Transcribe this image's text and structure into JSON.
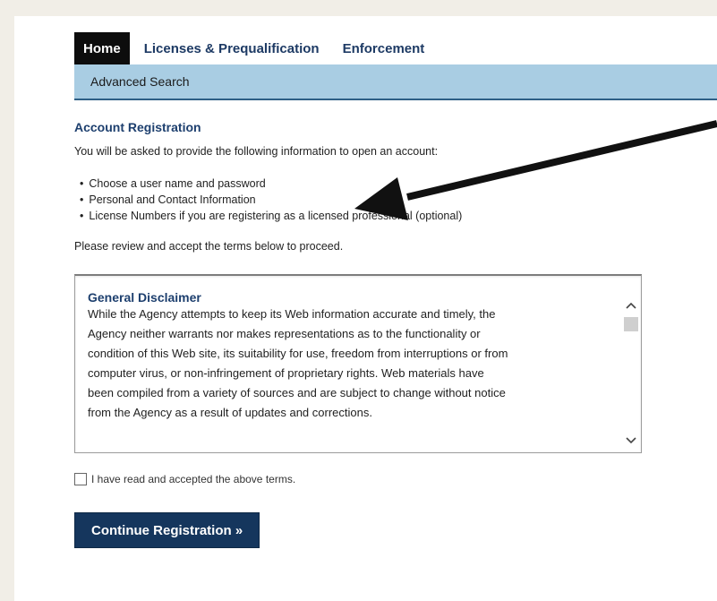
{
  "tabs": [
    {
      "label": "Home",
      "active": true
    },
    {
      "label": "Licenses & Prequalification",
      "active": false
    },
    {
      "label": "Enforcement",
      "active": false
    }
  ],
  "subnav": {
    "link": "Advanced Search"
  },
  "registration": {
    "title": "Account Registration",
    "intro": "You will be asked to provide the following information to open an account:",
    "bullets": [
      "Choose a user name and password",
      "Personal and Contact Information",
      "License Numbers if you are registering as a licensed professional (optional)"
    ],
    "review": "Please review and accept the terms below to proceed."
  },
  "terms": {
    "title": "General Disclaimer",
    "lines": [
      "While the Agency attempts to keep its Web information accurate and timely, the",
      "Agency neither warrants nor makes representations as to the functionality or",
      "condition of this Web site, its suitability for use, freedom from interruptions or from",
      "computer virus, or non-infringement of proprietary rights. Web materials have",
      "been compiled from a variety of sources and are subject to change without notice",
      "from the Agency as a result of updates and corrections."
    ]
  },
  "accept": {
    "label": "I have read and accepted the above terms.",
    "checked": false
  },
  "continue_button": "Continue Registration »",
  "colors": {
    "accent": "#15365d",
    "subnav": "#a9cde3",
    "background": "#f1eee7"
  }
}
